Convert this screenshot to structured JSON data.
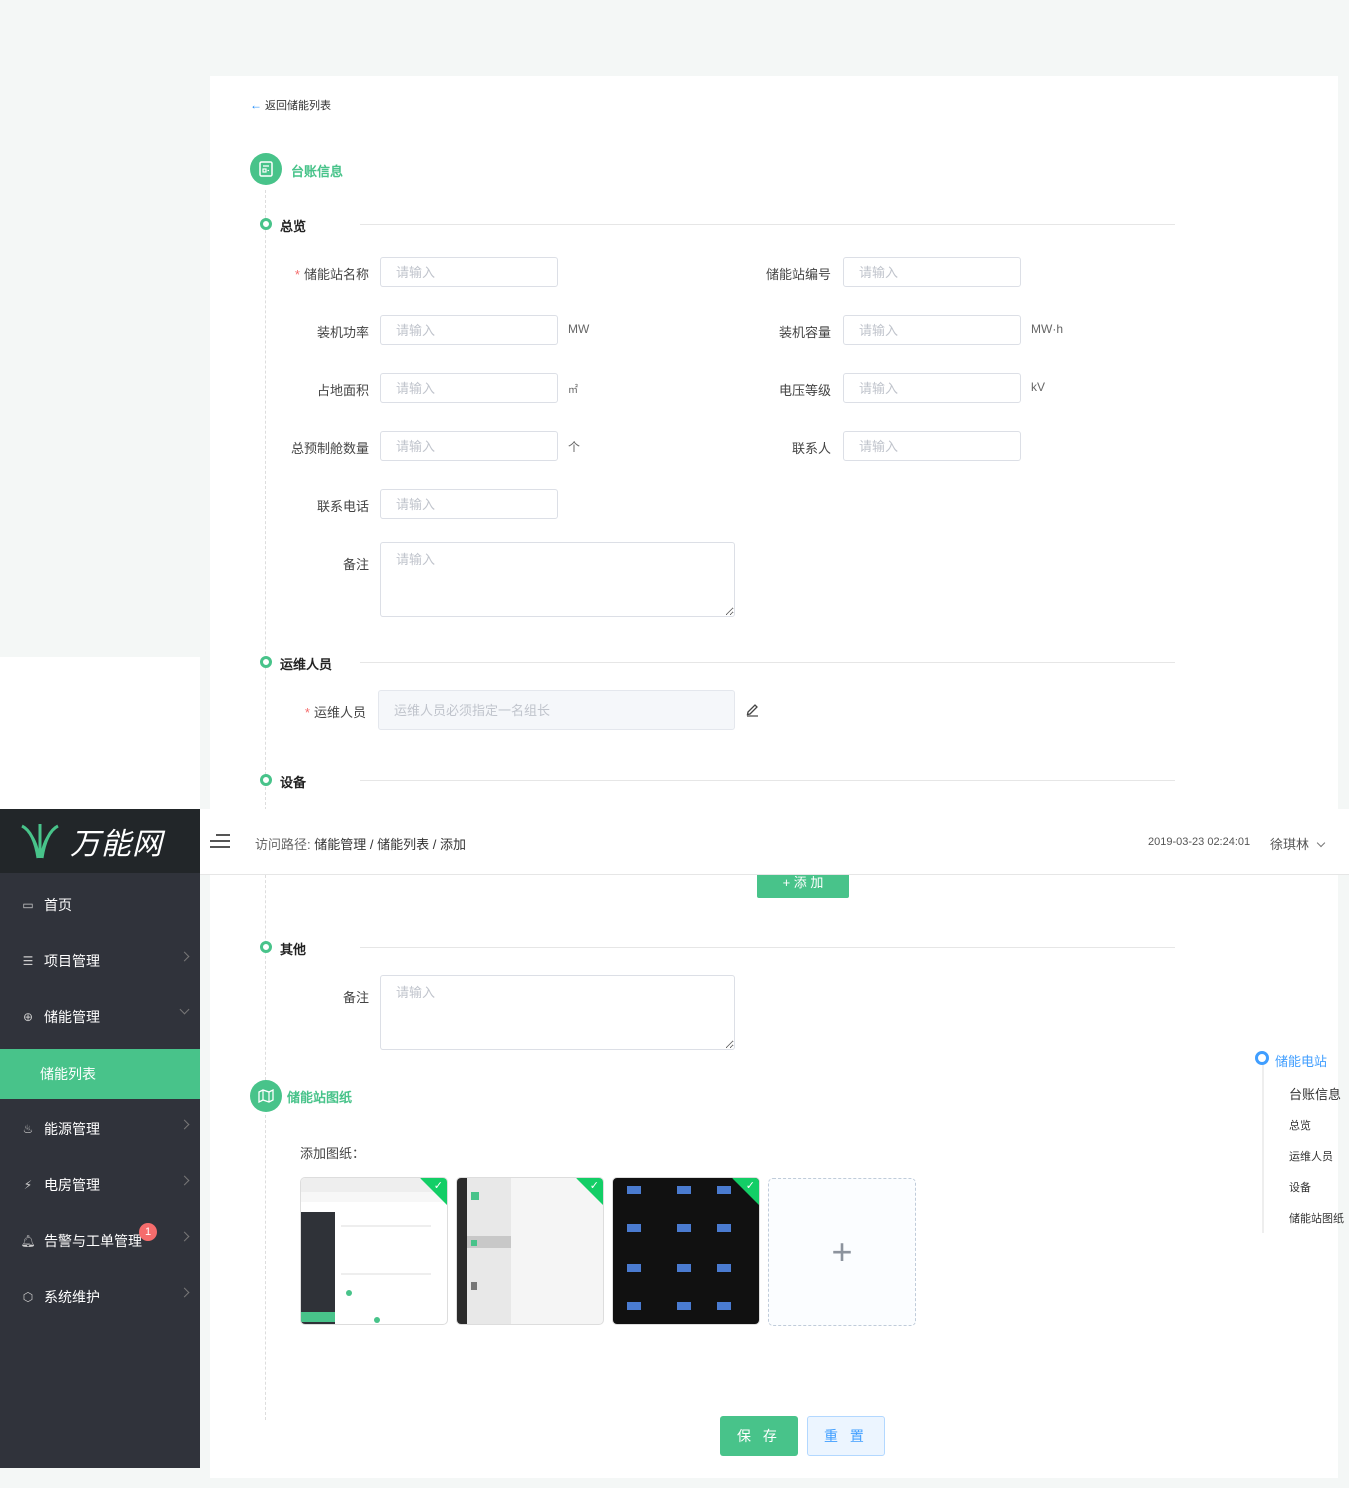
{
  "app": {
    "logo_text": "万能网"
  },
  "sidebar": {
    "items": [
      {
        "label": "首页",
        "icon": "monitor-icon"
      },
      {
        "label": "项目管理",
        "icon": "project-icon"
      },
      {
        "label": "储能管理",
        "icon": "storage-icon"
      },
      {
        "label": "储能列表",
        "icon": ""
      },
      {
        "label": "能源管理",
        "icon": "fire-icon"
      },
      {
        "label": "电房管理",
        "icon": "power-icon"
      },
      {
        "label": "告警与工单管理",
        "icon": "bell-icon",
        "badge": "1"
      },
      {
        "label": "系统维护",
        "icon": "shield-icon"
      }
    ]
  },
  "header": {
    "crumb_prefix": "访问路径:",
    "crumbs": [
      "储能管理",
      "储能列表",
      "添加"
    ],
    "crumb_sep": "/",
    "time": "2019-03-23 02:24:01",
    "user": "徐琪林"
  },
  "page": {
    "back_label": "返回储能列表",
    "section1_title": "台账信息",
    "overview_title": "总览",
    "fields": {
      "name": {
        "label": "储能站名称",
        "placeholder": "请输入"
      },
      "code": {
        "label": "储能站编号",
        "placeholder": "请输入"
      },
      "power": {
        "label": "装机功率",
        "placeholder": "请输入",
        "unit": "MW"
      },
      "capacity": {
        "label": "装机容量",
        "placeholder": "请输入",
        "unit": "MW·h"
      },
      "area": {
        "label": "占地面积",
        "placeholder": "请输入",
        "unit": "㎡"
      },
      "voltage": {
        "label": "电压等级",
        "placeholder": "请输入",
        "unit": "kV"
      },
      "cabins": {
        "label": "总预制舱数量",
        "placeholder": "请输入",
        "unit": "个"
      },
      "contact": {
        "label": "联系人",
        "placeholder": "请输入"
      },
      "phone": {
        "label": "联系电话",
        "placeholder": "请输入"
      },
      "remark": {
        "label": "备注",
        "placeholder": "请输入"
      }
    },
    "staff_title": "运维人员",
    "staff_label": "运维人员",
    "staff_placeholder": "运维人员必须指定一名组长",
    "device_title": "设备",
    "add_button": "+ 添 加",
    "other_title": "其他",
    "other_remark_label": "备注",
    "other_remark_placeholder": "请输入",
    "section2_title": "储能站图纸",
    "drawings_label": "添加图纸：",
    "save_button": "保 存",
    "reset_button": "重 置"
  },
  "anchor": {
    "root": "储能电站",
    "items": [
      "台账信息",
      "总览",
      "运维人员",
      "设备",
      "储能站图纸"
    ]
  },
  "colors": {
    "accent": "#48c38a",
    "sidebar": "#30333b",
    "link": "#409eff",
    "danger": "#f56c6c"
  }
}
